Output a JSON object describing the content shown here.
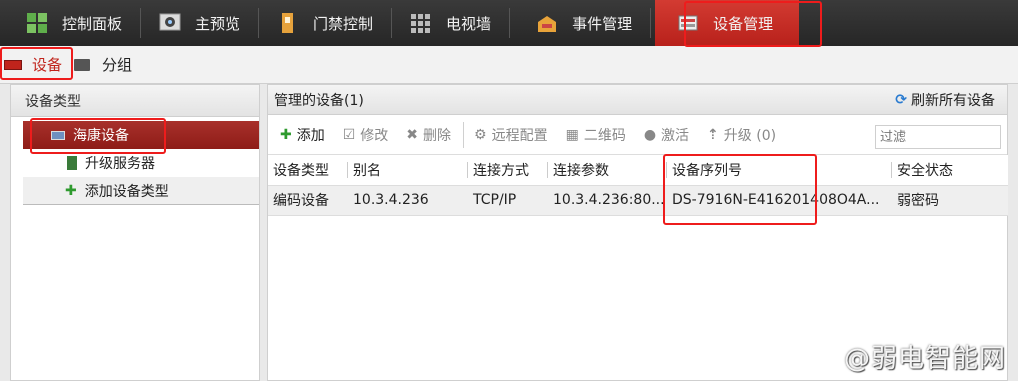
{
  "topnav": {
    "items": [
      {
        "label": "控制面板",
        "icon": "dashboard-icon"
      },
      {
        "label": "主预览",
        "icon": "preview-icon"
      },
      {
        "label": "门禁控制",
        "icon": "door-access-icon"
      },
      {
        "label": "电视墙",
        "icon": "video-wall-icon"
      },
      {
        "label": "事件管理",
        "icon": "event-icon"
      },
      {
        "label": "设备管理",
        "icon": "device-manage-icon"
      }
    ],
    "active": "设备管理"
  },
  "subnav": {
    "device_tab": "设备",
    "group_tab": "分组"
  },
  "left": {
    "title": "设备类型",
    "items": [
      "海康设备",
      "升级服务器",
      "添加设备类型"
    ]
  },
  "right": {
    "title": "管理的设备(1)",
    "refresh_label": "刷新所有设备",
    "toolbar": {
      "add": "添加",
      "modify": "修改",
      "delete": "删除",
      "remote_config": "远程配置",
      "qrcode": "二维码",
      "activate": "激活",
      "upgrade": "升级 (0)"
    },
    "filter_placeholder": "过滤",
    "columns": [
      "设备类型",
      "别名",
      "连接方式",
      "连接参数",
      "设备序列号",
      "安全状态"
    ],
    "rows": [
      [
        "编码设备",
        "10.3.4.236",
        "TCP/IP",
        "10.3.4.236:80...",
        "DS-7916N-E416201408O4A...",
        "弱密码"
      ]
    ]
  },
  "watermark": "@弱电智能网",
  "colors": {
    "accent_red": "#c0241c",
    "highlight": "#ee1c1c",
    "nav_bg": "#2e2e2e"
  }
}
